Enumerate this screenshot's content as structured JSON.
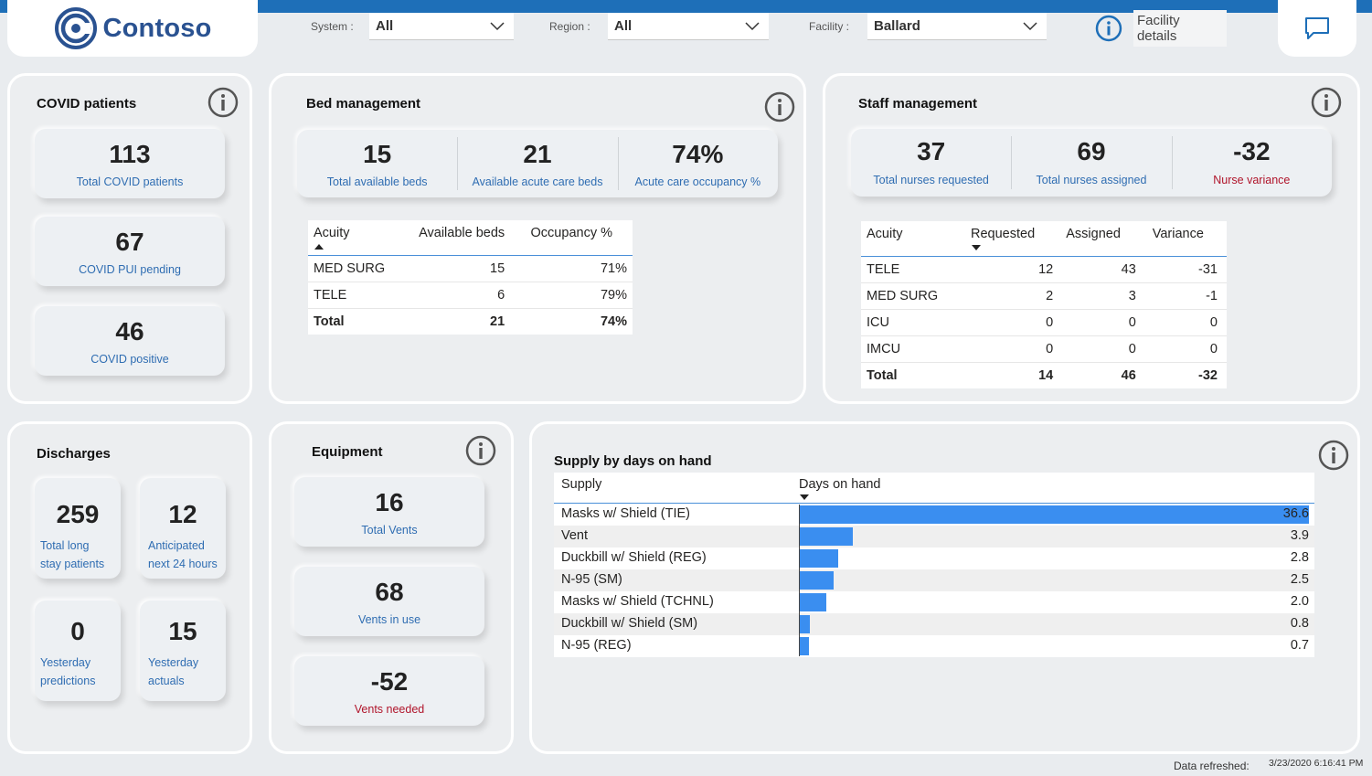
{
  "brand": {
    "name": "Contoso"
  },
  "filters": {
    "system": {
      "label": "System :",
      "value": "All"
    },
    "region": {
      "label": "Region :",
      "value": "All"
    },
    "facility": {
      "label": "Facility :",
      "value": "Ballard"
    }
  },
  "facility_details": {
    "label": "Facility details"
  },
  "covid": {
    "title": "COVID patients",
    "kpis": [
      {
        "value": "113",
        "label": "Total COVID patients"
      },
      {
        "value": "67",
        "label": "COVID PUI pending"
      },
      {
        "value": "46",
        "label": "COVID positive"
      }
    ]
  },
  "beds": {
    "title": "Bed management",
    "kpis": [
      {
        "value": "15",
        "label": "Total available beds"
      },
      {
        "value": "21",
        "label": "Available acute care beds"
      },
      {
        "value": "74%",
        "label": "Acute care occupancy %"
      }
    ],
    "table": {
      "headers": [
        "Acuity",
        "Available beds",
        "Occupancy %"
      ],
      "rows": [
        [
          "MED SURG",
          "15",
          "71%"
        ],
        [
          "TELE",
          "6",
          "79%"
        ]
      ],
      "total": [
        "Total",
        "21",
        "74%"
      ]
    }
  },
  "staff": {
    "title": "Staff management",
    "kpis": [
      {
        "value": "37",
        "label": "Total nurses requested"
      },
      {
        "value": "69",
        "label": "Total nurses assigned"
      },
      {
        "value": "-32",
        "label": "Nurse variance"
      }
    ],
    "table": {
      "headers": [
        "Acuity",
        "Requested",
        "Assigned",
        "Variance"
      ],
      "rows": [
        [
          "TELE",
          "12",
          "43",
          "-31"
        ],
        [
          "MED SURG",
          "2",
          "3",
          "-1"
        ],
        [
          "ICU",
          "0",
          "0",
          "0"
        ],
        [
          "IMCU",
          "0",
          "0",
          "0"
        ]
      ],
      "total": [
        "Total",
        "14",
        "46",
        "-32"
      ]
    }
  },
  "discharges": {
    "title": "Discharges",
    "kpis": [
      {
        "value": "259",
        "label1": "Total long",
        "label2": "stay patients"
      },
      {
        "value": "12",
        "label1": "Anticipated",
        "label2": "next 24 hours"
      },
      {
        "value": "0",
        "label1": "Yesterday",
        "label2": "predictions"
      },
      {
        "value": "15",
        "label1": "Yesterday",
        "label2": "actuals"
      }
    ]
  },
  "equipment": {
    "title": "Equipment",
    "kpis": [
      {
        "value": "16",
        "label": "Total Vents"
      },
      {
        "value": "68",
        "label": "Vents in use"
      },
      {
        "value": "-52",
        "label": "Vents needed"
      }
    ]
  },
  "supply": {
    "title": "Supply by days on hand",
    "col1": "Supply",
    "col2": "Days on hand"
  },
  "chart_data": {
    "type": "bar",
    "title": "Supply by days on hand",
    "categories": [
      "Masks w/ Shield (TIE)",
      "Vent",
      "Duckbill w/ Shield (REG)",
      "N-95 (SM)",
      "Masks w/ Shield (TCHNL)",
      "Duckbill w/ Shield (SM)",
      "N-95 (REG)"
    ],
    "values": [
      36.6,
      3.9,
      2.8,
      2.5,
      2.0,
      0.8,
      0.7
    ],
    "value_labels": [
      "36.6",
      "3.9",
      "2.8",
      "2.5",
      "2.0",
      "0.8",
      "0.7"
    ],
    "orientation": "horizontal",
    "bar_color": "#3a8ef0"
  },
  "footer": {
    "label": "Data refreshed:",
    "timestamp": "3/23/2020 6:16:41 PM"
  },
  "colors": {
    "accent": "#1e6fb8",
    "kpi_label": "#2f6db2",
    "negative": "#b0142a",
    "bar": "#3a8ef0"
  }
}
